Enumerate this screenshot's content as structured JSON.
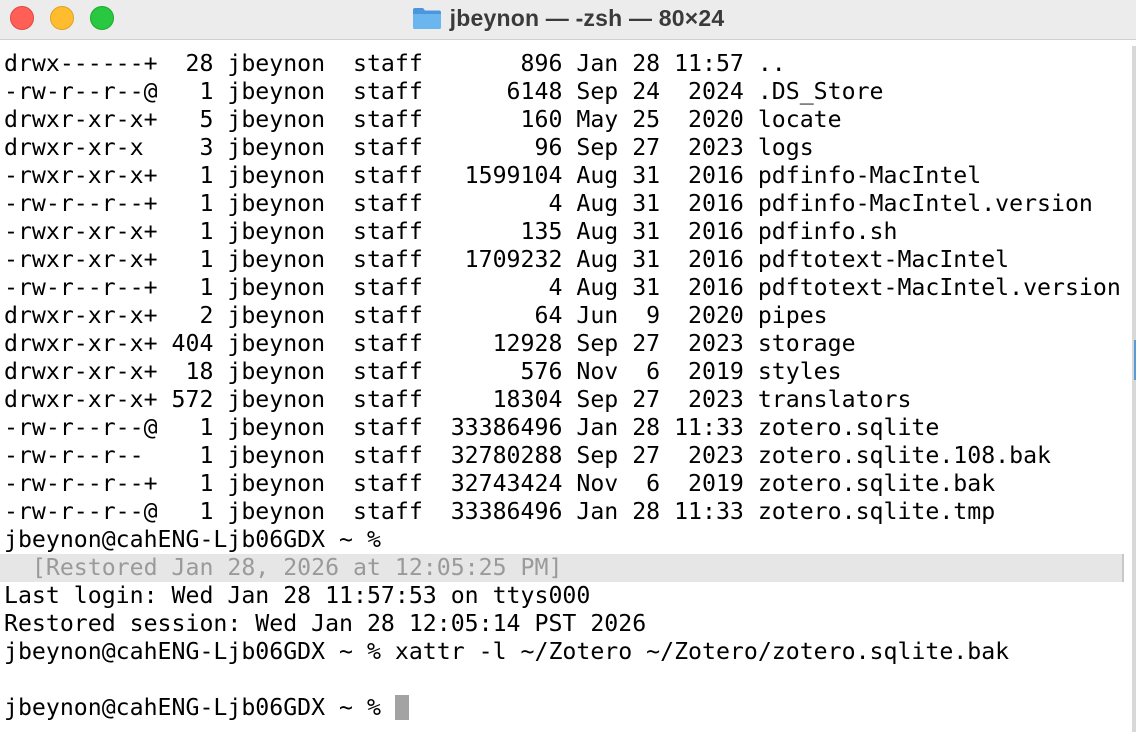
{
  "window": {
    "title": "jbeynon — -zsh — 80×24"
  },
  "terminal": {
    "lines": [
      "drwx------+  28 jbeynon  staff       896 Jan 28 11:57 ..",
      "-rw-r--r--@   1 jbeynon  staff      6148 Sep 24  2024 .DS_Store",
      "drwxr-xr-x+   5 jbeynon  staff       160 May 25  2020 locate",
      "drwxr-xr-x    3 jbeynon  staff        96 Sep 27  2023 logs",
      "-rwxr-xr-x+   1 jbeynon  staff   1599104 Aug 31  2016 pdfinfo-MacIntel",
      "-rw-r--r--+   1 jbeynon  staff         4 Aug 31  2016 pdfinfo-MacIntel.version",
      "-rwxr-xr-x+   1 jbeynon  staff       135 Aug 31  2016 pdfinfo.sh",
      "-rwxr-xr-x+   1 jbeynon  staff   1709232 Aug 31  2016 pdftotext-MacIntel",
      "-rw-r--r--+   1 jbeynon  staff         4 Aug 31  2016 pdftotext-MacIntel.version",
      "drwxr-xr-x+   2 jbeynon  staff        64 Jun  9  2020 pipes",
      "drwxr-xr-x+ 404 jbeynon  staff     12928 Sep 27  2023 storage",
      "drwxr-xr-x+  18 jbeynon  staff       576 Nov  6  2019 styles",
      "drwxr-xr-x+ 572 jbeynon  staff     18304 Sep 27  2023 translators",
      "-rw-r--r--@   1 jbeynon  staff  33386496 Jan 28 11:33 zotero.sqlite",
      "-rw-r--r--    1 jbeynon  staff  32780288 Sep 27  2023 zotero.sqlite.108.bak",
      "-rw-r--r--+   1 jbeynon  staff  32743424 Nov  6  2019 zotero.sqlite.bak",
      "-rw-r--r--@   1 jbeynon  staff  33386496 Jan 28 11:33 zotero.sqlite.tmp",
      "jbeynon@cahENG-Ljb06GDX ~ %"
    ],
    "restored_banner": "  [Restored Jan 28, 2026 at 12:05:25 PM]",
    "after_lines": [
      "Last login: Wed Jan 28 11:57:53 on ttys000",
      "Restored session: Wed Jan 28 12:05:14 PST 2026",
      "jbeynon@cahENG-Ljb06GDX ~ % xattr -l ~/Zotero ~/Zotero/zotero.sqlite.bak",
      ""
    ],
    "prompt": "jbeynon@cahENG-Ljb06GDX ~ % "
  },
  "colors": {
    "close": "#ff5f57",
    "minimize": "#febc2e",
    "maximize": "#28c840",
    "folder": "#5aa7e8"
  }
}
